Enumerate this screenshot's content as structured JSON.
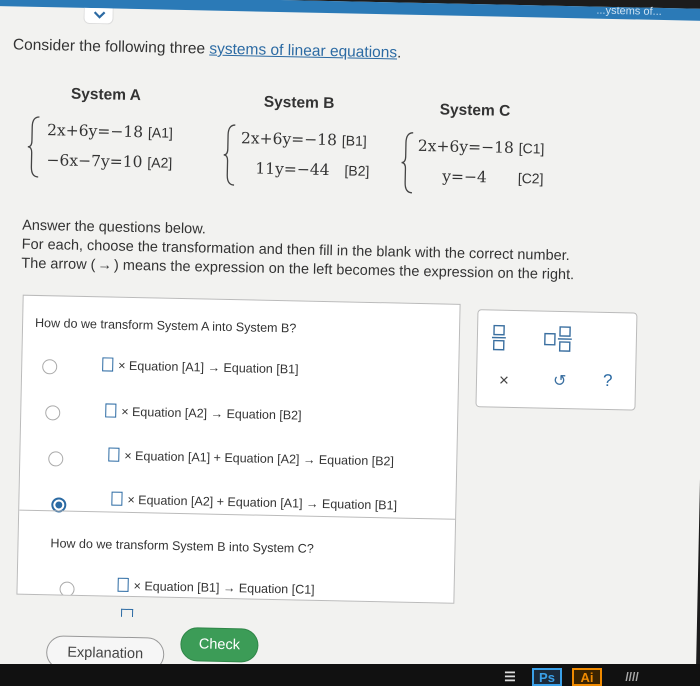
{
  "header": {
    "title": "...ystems of..."
  },
  "intro": {
    "prefix": "Consider the following three ",
    "link": "systems of linear equations",
    "suffix": "."
  },
  "systems": {
    "A": {
      "heading": "System A",
      "eq1": {
        "text": "2x+6y=−18",
        "tag": "[A1]"
      },
      "eq2": {
        "text": "−6x−7y=10",
        "tag": "[A2]"
      }
    },
    "B": {
      "heading": "System B",
      "eq1": {
        "text": "2x+6y=−18",
        "tag": "[B1]"
      },
      "eq2": {
        "text": "11y=−44",
        "tag": "[B2]"
      }
    },
    "C": {
      "heading": "System C",
      "eq1": {
        "text": "2x+6y=−18",
        "tag": "[C1]"
      },
      "eq2": {
        "text": "y=−4",
        "tag": "[C2]"
      }
    }
  },
  "instructions": {
    "line1": "Answer the questions below.",
    "line2": "For each, choose the transformation and then fill in the blank with the correct number.",
    "line3_prefix": "The arrow (",
    "line3_arrow": "→",
    "line3_suffix": ") means the expression on the left becomes the expression on the right."
  },
  "question1": {
    "prompt": "How do we transform System A into System B?",
    "options": [
      {
        "text": "× Equation [A1] → Equation [B1]",
        "selected": false
      },
      {
        "text": "× Equation [A2] → Equation [B2]",
        "selected": false
      },
      {
        "text": "× Equation [A1] + Equation [A2] → Equation [B2]",
        "selected": false
      },
      {
        "text": "× Equation [A2] + Equation [A1] → Equation [B1]",
        "selected": true
      }
    ]
  },
  "question2": {
    "prompt": "How do we transform System B into System C?",
    "options": [
      {
        "text": "× Equation [B1] → Equation [C1]",
        "selected": false
      }
    ]
  },
  "toolbox": {
    "fraction_icon": "fraction-icon",
    "mixed_number_icon": "mixed-number-icon",
    "clear": "×",
    "undo": "↺",
    "help": "?"
  },
  "buttons": {
    "explanation": "Explanation",
    "check": "Check"
  },
  "taskbar": {
    "ps": "Ps",
    "ai": "Ai"
  },
  "colors": {
    "accent": "#2b6aa3",
    "check_green": "#3c9c57",
    "topbar": "#2b7ab7"
  }
}
